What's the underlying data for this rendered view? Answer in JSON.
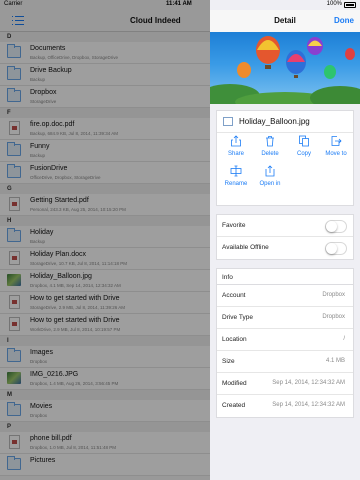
{
  "status": {
    "carrier": "Carrier",
    "time": "11:41 AM",
    "battery": "100%"
  },
  "list_nav": {
    "title": "Cloud Indeed"
  },
  "sections": [
    {
      "letter": "D",
      "rows": [
        {
          "name": "Documents",
          "meta": "Backup, OfficeDrive, Dropbox, StorageDrive",
          "icon": "folder-icon"
        },
        {
          "name": "Drive Backup",
          "meta": "Backup",
          "icon": "folder-icon"
        },
        {
          "name": "Dropbox",
          "meta": "StorageDrive",
          "icon": "folder-icon"
        }
      ]
    },
    {
      "letter": "F",
      "rows": [
        {
          "name": "fire.op.doc.pdf",
          "meta": "Backup, 684.9 KB, Jul 8, 2014, 11:39:34 AM",
          "icon": "pdf-icon"
        },
        {
          "name": "Funny",
          "meta": "Backup",
          "icon": "folder-icon"
        },
        {
          "name": "FusionDrive",
          "meta": "OfficeDrive, Dropbox, StorageDrive",
          "icon": "folder-icon"
        }
      ]
    },
    {
      "letter": "G",
      "rows": [
        {
          "name": "Getting Started.pdf",
          "meta": "Personal, 243.3 KB, Aug 25, 2014, 10:15:20 PM",
          "icon": "pdf-icon"
        }
      ]
    },
    {
      "letter": "H",
      "rows": [
        {
          "name": "Holiday",
          "meta": "Backup",
          "icon": "folder-icon"
        },
        {
          "name": "Holiday Plan.docx",
          "meta": "StorageDrive, 10.7 KB, Jul 8, 2014, 11:14:18 PM",
          "icon": "docx-icon"
        },
        {
          "name": "Holiday_Balloon.jpg",
          "meta": "Dropbox, 4.1 MB, Sep 14, 2014, 12:34:32 AM",
          "icon": "image-thumbnail"
        },
        {
          "name": "How to get started with Drive",
          "meta": "StorageDrive, 2.9 MB, Jul 8, 2014, 11:39:26 AM",
          "icon": "drive-doc-icon"
        },
        {
          "name": "How to get started with Drive",
          "meta": "WorkDrive, 2.9 MB, Jul 8, 2014, 10:19:57 PM",
          "icon": "drive-doc-icon"
        }
      ]
    },
    {
      "letter": "I",
      "rows": [
        {
          "name": "Images",
          "meta": "Dropbox",
          "icon": "folder-icon"
        },
        {
          "name": "IMG_0216.JPG",
          "meta": "Dropbox, 1.4 MB, Aug 26, 2014, 3:56:45 PM",
          "icon": "image-thumbnail"
        }
      ]
    },
    {
      "letter": "M",
      "rows": [
        {
          "name": "Movies",
          "meta": "Dropbox",
          "icon": "folder-icon"
        }
      ]
    },
    {
      "letter": "P",
      "rows": [
        {
          "name": "phone bill.pdf",
          "meta": "Dropbox, 1.0 MB, Jul 8, 2014, 11:51:48 PM",
          "icon": "pdf-icon"
        },
        {
          "name": "Pictures",
          "meta": "",
          "icon": "folder-icon"
        }
      ]
    }
  ],
  "detail": {
    "title": "Detail",
    "done_label": "Done",
    "file_name": "Holiday_Balloon.jpg",
    "actions": [
      {
        "label": "Share",
        "icon": "share-icon"
      },
      {
        "label": "Delete",
        "icon": "trash-icon"
      },
      {
        "label": "Copy",
        "icon": "copy-icon"
      },
      {
        "label": "Move to",
        "icon": "move-icon"
      },
      {
        "label": "Rename",
        "icon": "rename-icon"
      },
      {
        "label": "Open in",
        "icon": "open-in-icon"
      }
    ],
    "toggles": [
      {
        "label": "Favorite",
        "on": false
      },
      {
        "label": "Available Offline",
        "on": false
      }
    ],
    "info_header": "Info",
    "info": [
      {
        "label": "Account",
        "value": "Dropbox"
      },
      {
        "label": "Drive Type",
        "value": "Dropbox"
      },
      {
        "label": "Location",
        "value": "/"
      },
      {
        "label": "Size",
        "value": "4.1 MB"
      },
      {
        "label": "Modified",
        "value": "Sep 14, 2014, 12:34:32 AM"
      },
      {
        "label": "Created",
        "value": "Sep 14, 2014, 12:34:32 AM"
      }
    ]
  },
  "colors": {
    "accent": "#1b7cf5",
    "background": "#efeff4"
  }
}
